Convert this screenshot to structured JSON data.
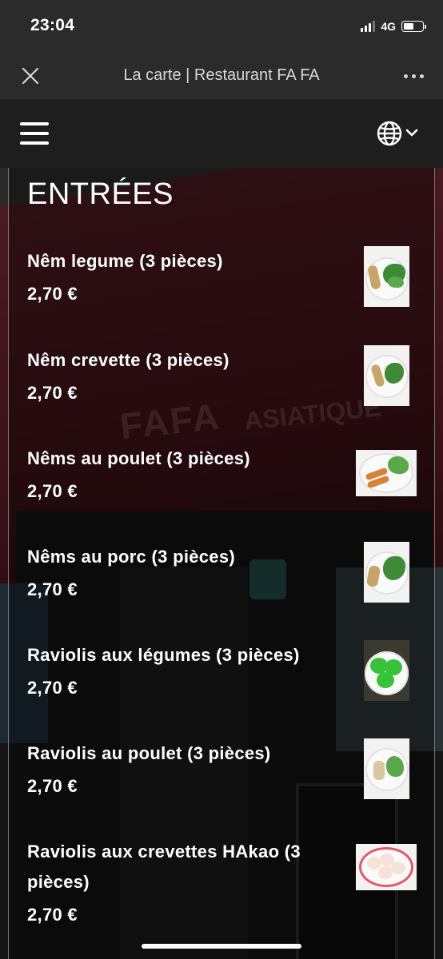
{
  "status_bar": {
    "time": "23:04",
    "network": "4G",
    "icons": [
      "signal-icon",
      "battery-icon"
    ]
  },
  "browser": {
    "title": "La carte | Restaurant FA FA",
    "icons": [
      "close-icon",
      "more-icon"
    ]
  },
  "header": {
    "icons": [
      "hamburger-menu-icon",
      "globe-icon",
      "chevron-down-icon"
    ]
  },
  "background_sign": {
    "left_text": "FAFA",
    "right_text": "ASIATIQUE"
  },
  "section": {
    "title": "ENTRÉES"
  },
  "items": [
    {
      "name": "Nêm legume (3 pièces)",
      "price": "2,70 €",
      "image": "nem-plate-thumbnail"
    },
    {
      "name": "Nêm crevette (3 pièces)",
      "price": "2,70 €",
      "image": "nem-plate-thumbnail"
    },
    {
      "name": "Nêms au poulet (3 pièces)",
      "price": "2,70 €",
      "image": "fried-nems-thumbnail"
    },
    {
      "name": "Nêms au porc (3 pièces)",
      "price": "2,70 €",
      "image": "nem-plate-thumbnail"
    },
    {
      "name": "Raviolis aux légumes (3 pièces)",
      "price": "2,70 €",
      "image": "green-dumplings-thumbnail"
    },
    {
      "name": "Raviolis au poulet (3 pièces)",
      "price": "2,70 €",
      "image": "dumpling-plate-thumbnail"
    },
    {
      "name": "Raviolis aux crevettes HAkao (3 pièces)",
      "price": "2,70 €",
      "image": "hakao-thumbnail"
    }
  ],
  "colors": {
    "bar_background": "#2b2b2b",
    "header_background": "#1e1e1e",
    "text": "#ffffff"
  }
}
